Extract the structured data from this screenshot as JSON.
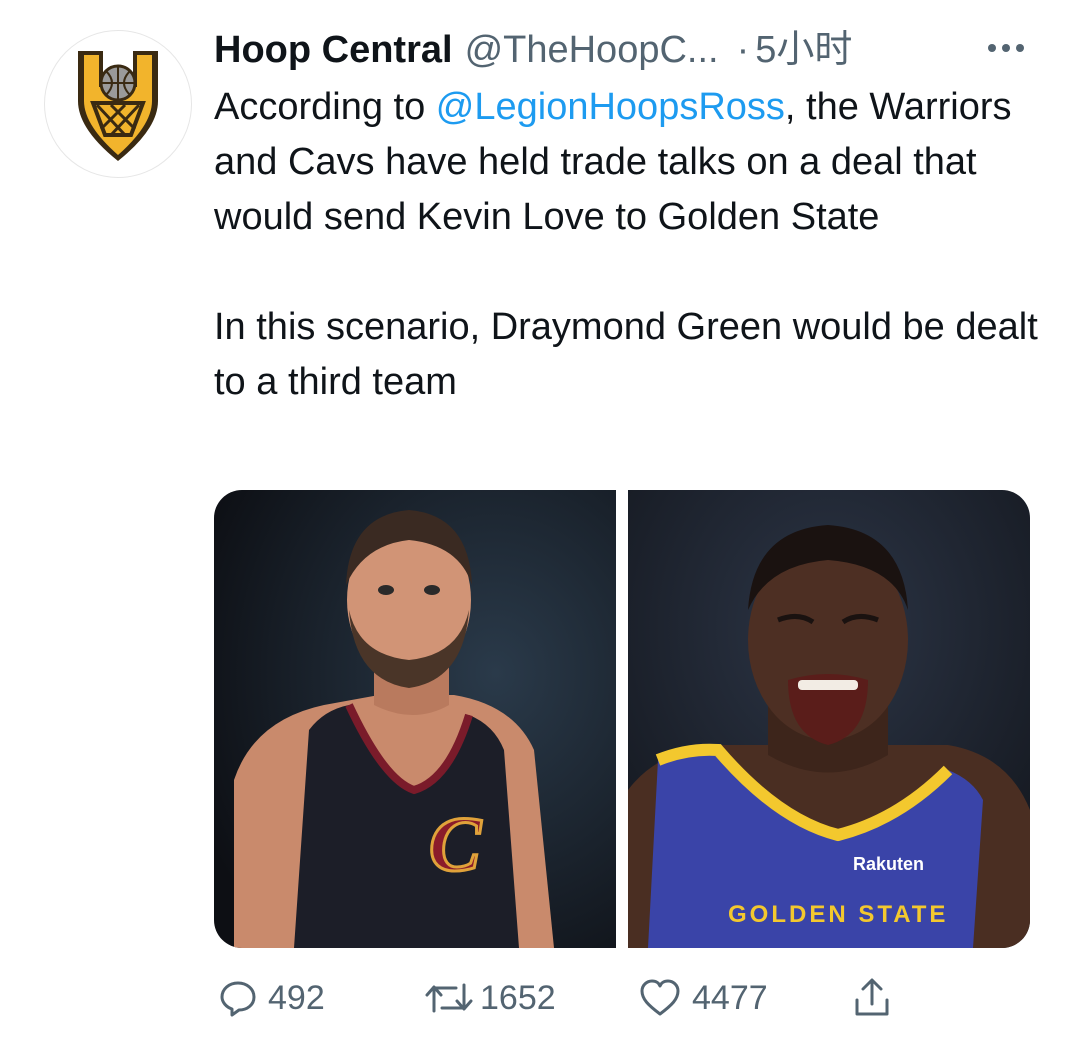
{
  "tweet": {
    "display_name": "Hoop Central",
    "handle": "@TheHoopC...",
    "separator": "·",
    "time": "5小时",
    "text_prefix": "According to ",
    "mention": "@LegionHoopsRoss",
    "text_suffix": ", the Warriors and Cavs have held trade talks on a deal that would send Kevin Love to Golden State",
    "text_second": "In this scenario, Draymond Green would be dealt to a third team"
  },
  "media": {
    "left_photo": {
      "jersey_text": "C"
    },
    "right_photo": {
      "jersey_sponsor": "Rakuten",
      "jersey_arc_text": "GOLDEN STATE"
    }
  },
  "actions": {
    "reply_count": "492",
    "retweet_count": "1652",
    "like_count": "4477"
  },
  "icons": {
    "avatar": "hoop-central-logo",
    "more": "more-dots-icon",
    "reply": "comment-bubble-icon",
    "retweet": "retweet-arrows-icon",
    "like": "heart-icon",
    "share": "share-upload-icon"
  },
  "colors": {
    "text": "#0f1419",
    "muted": "#536471",
    "link": "#1d9bf0",
    "logo_gold": "#f2b42c",
    "logo_dark": "#3a2a12"
  }
}
